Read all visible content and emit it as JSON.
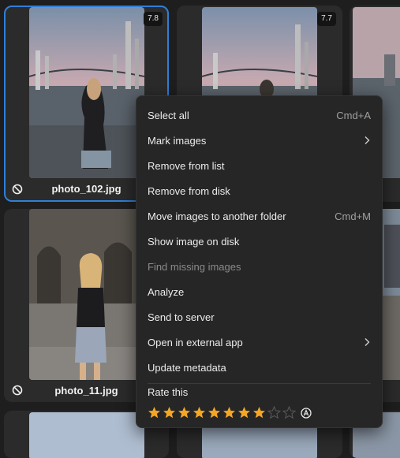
{
  "photos": [
    {
      "filename": "photo_102.jpg",
      "score": "7.8"
    },
    {
      "filename": "",
      "score": "7.7"
    },
    {
      "filename": "photo_11.jpg",
      "score": ""
    }
  ],
  "menu": {
    "items": [
      {
        "label": "Select all",
        "shortcut": "Cmd+A"
      },
      {
        "label": "Mark images",
        "shortcut": ""
      },
      {
        "label": "Remove from list",
        "shortcut": ""
      },
      {
        "label": "Remove from disk",
        "shortcut": ""
      },
      {
        "label": "Move images to another folder",
        "shortcut": "Cmd+M"
      },
      {
        "label": "Show image on disk",
        "shortcut": ""
      },
      {
        "label": "Find missing images",
        "shortcut": ""
      },
      {
        "label": "Analyze",
        "shortcut": ""
      },
      {
        "label": "Send to server",
        "shortcut": ""
      },
      {
        "label": "Open in external app",
        "shortcut": ""
      },
      {
        "label": "Update metadata",
        "shortcut": ""
      }
    ],
    "rate_label": "Rate this",
    "rating": {
      "value": 8,
      "max": 10,
      "star_color": "#f5a623",
      "empty_color": "#5a5a5a"
    }
  },
  "icons": {
    "unrated": "ban-icon",
    "submenu": "chevron-right-icon",
    "auto_rating": "circled-a-icon"
  },
  "colors": {
    "selection": "#2f7fd6",
    "background": "#1e1e1e",
    "card": "#2b2b2b"
  }
}
